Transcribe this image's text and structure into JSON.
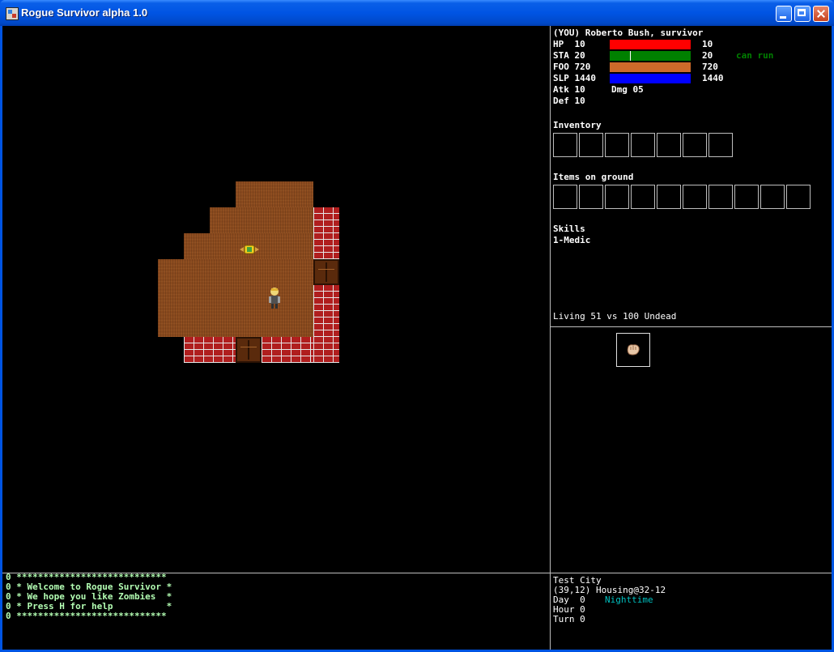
{
  "window": {
    "title": "Rogue Survivor alpha 1.0"
  },
  "player": {
    "header": "(YOU) Roberto Bush, survivor",
    "stats": [
      {
        "label": "HP  10",
        "max": "10",
        "value": 10,
        "max_value": 10,
        "color": "#ff0000"
      },
      {
        "label": "STA 20",
        "max": "20",
        "value": 20,
        "max_value": 20,
        "color": "#008000"
      },
      {
        "label": "FOO 720",
        "max": "720",
        "value": 720,
        "max_value": 720,
        "color": "#cd6a2a"
      },
      {
        "label": "SLP 1440",
        "max": "1440",
        "value": 1440,
        "max_value": 1440,
        "color": "#0000ff"
      }
    ],
    "run_status": "can run",
    "atk": "Atk 10",
    "dmg": "Dmg 05",
    "def": "Def 10"
  },
  "inventory": {
    "label": "Inventory"
  },
  "ground": {
    "label": "Items on ground"
  },
  "skills": {
    "label": "Skills",
    "items": [
      "1-Medic"
    ]
  },
  "census": "Living 51 vs 100 Undead",
  "messages": [
    "0 ****************************",
    "0 * Welcome to Rogue Survivor *",
    "0 * We hope you like Zombies  *",
    "0 * Press H for help          *",
    "0 ****************************"
  ],
  "location": {
    "city": "Test City",
    "position": "(39,12) Housing@32-12",
    "day": "Day  0",
    "time_of_day": "Nighttime",
    "hour": "Hour 0",
    "turn": "Turn 0"
  },
  "colors": {
    "message_text": "#b4ffb4",
    "run_status": "#008000",
    "nighttime": "#00c0c0",
    "brick": "#b01e1e",
    "floor": "#8a4a1e"
  },
  "icons": {
    "player": "survivor-sprite",
    "item_on_map": "food-item-icon",
    "selected_item": "fist-icon"
  }
}
